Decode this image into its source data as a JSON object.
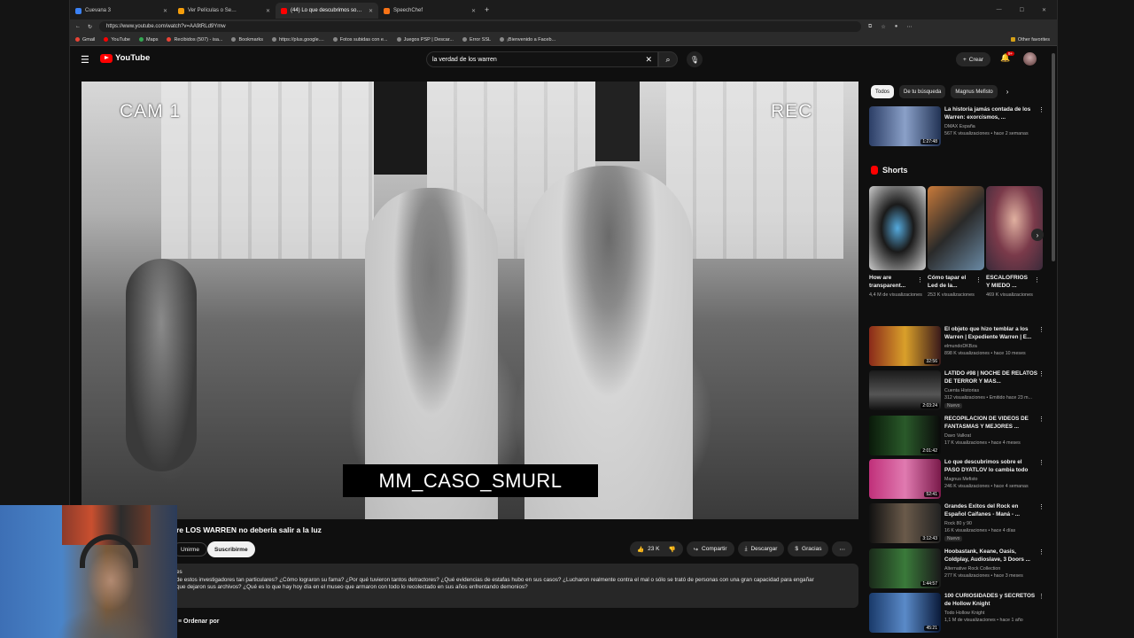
{
  "browser": {
    "tabs": [
      {
        "label": "Cuevana 3",
        "active": false,
        "color": "#3b82f6"
      },
      {
        "label": "Ver Películas o Se…",
        "active": false,
        "color": "#f59e0b"
      },
      {
        "label": "(44) Lo que descubrimos so…",
        "active": true,
        "color": "#ff0000"
      },
      {
        "label": "SpeechChef",
        "active": false,
        "color": "#f97316"
      }
    ],
    "url": "https://www.youtube.com/watch?v=AA9tRLd9Ymw",
    "bookmarks": [
      "Gmail",
      "YouTube",
      "Maps",
      "Recibidos (507) - isa...",
      "Bookmarks",
      "https://plus.google....",
      "Fotos subidas con e...",
      "Juegos PSP | Descar...",
      "Error SSL",
      "¡Bienvenido a Faceb..."
    ],
    "other_favorites": "Other favorites"
  },
  "youtube": {
    "logo": "YouTube",
    "search_query": "la verdad de los warren",
    "create_label": "Crear",
    "notification_count": "9+"
  },
  "video": {
    "osd_left": "CAM 1",
    "osd_right": "REC",
    "caption": "MM_CASO_SMURL",
    "title": "re LOS WARREN no debería salir a la luz",
    "join_label": "Unirme",
    "subscribe_label": "Suscribirme",
    "likes": "23 K",
    "share_label": "Compartir",
    "download_label": "Descargar",
    "thanks_label": "Gracias",
    "description_lines": [
      "es",
      "de estos investigadores tan particulares? ¿Cómo lograron su fama? ¿Por qué tuvieron tantos detractores? ¿Qué evidencias de estafas hubo en sus casos? ¿Lucharon realmente contra el mal o sólo se trató de personas con una gran capacidad para engañar",
      "que dejaron sus archivos? ¿Qué es lo que hay hoy día en el museo que armaron con todo lo recolectado en sus años enfrentando demonios?"
    ],
    "sort_label": "Ordenar por"
  },
  "sidebar": {
    "chips": [
      "Todos",
      "De tu búsqueda",
      "Magnus Mefisto"
    ],
    "shorts_title": "Shorts",
    "top_video": {
      "title": "La historia jamás contada de los Warren: exorcismos, ...",
      "channel": "DMAX España",
      "meta": "567 K visualizaciones • hace 2 semanas",
      "duration": "1:27:48"
    },
    "shorts": [
      {
        "title": "How are transparent...",
        "views": "4,4 M de visualizaciones"
      },
      {
        "title": "Cómo tapar el Led de la...",
        "views": "253 K visualizaciones"
      },
      {
        "title": "ESCALOFRIOS Y MIEDO ...",
        "views": "469 K visualizaciones"
      }
    ],
    "videos": [
      {
        "title": "El objeto que hizo temblar a los Warren | Expediente Warren | E...",
        "channel": "elmundoDKBza",
        "meta": "898 K visualizaciones • hace 10 meses",
        "duration": "32:56",
        "new": ""
      },
      {
        "title": "LATIDO #98 | NOCHE DE RELATOS DE TERROR Y MAS...",
        "channel": "Cuenta Historias",
        "meta": "312 visualizaciones • Emitido hace 23 m...",
        "duration": "2:03:24",
        "new": "Nuevo"
      },
      {
        "title": "RECOPILACIÓN DE VIDEOS DE FANTASMAS Y MEJORES ...",
        "channel": "Davo Valkrat",
        "meta": "17 K visualizaciones • hace 4 meses",
        "duration": "2:01:42",
        "new": ""
      },
      {
        "title": "Lo que descubrimos sobre el PASO DYATLOV lo cambia todo",
        "channel": "Magnus Mefisto",
        "meta": "246 K visualizaciones • hace 4 semanas",
        "duration": "52:41",
        "new": ""
      },
      {
        "title": "Grandes Éxitos del Rock en Español Caifanes - Maná - ...",
        "channel": "Rock 80 y 90",
        "meta": "16 K visualizaciones • hace 4 días",
        "duration": "3:12:43",
        "new": "Nuevo"
      },
      {
        "title": "Hoobastank, Keane, Oasis, Coldplay, Audioslave, 3 Doors ...",
        "channel": "Alternative Rock Collection",
        "meta": "277 K visualizaciones • hace 3 meses",
        "duration": "1:44:57",
        "new": ""
      },
      {
        "title": "100 CURIOSIDADES y SECRETOS de Hollow Knight",
        "channel": "Todo Hollow Knight",
        "meta": "1,1 M de visualizaciones • hace 1 año",
        "duration": "45:21",
        "new": ""
      }
    ]
  }
}
